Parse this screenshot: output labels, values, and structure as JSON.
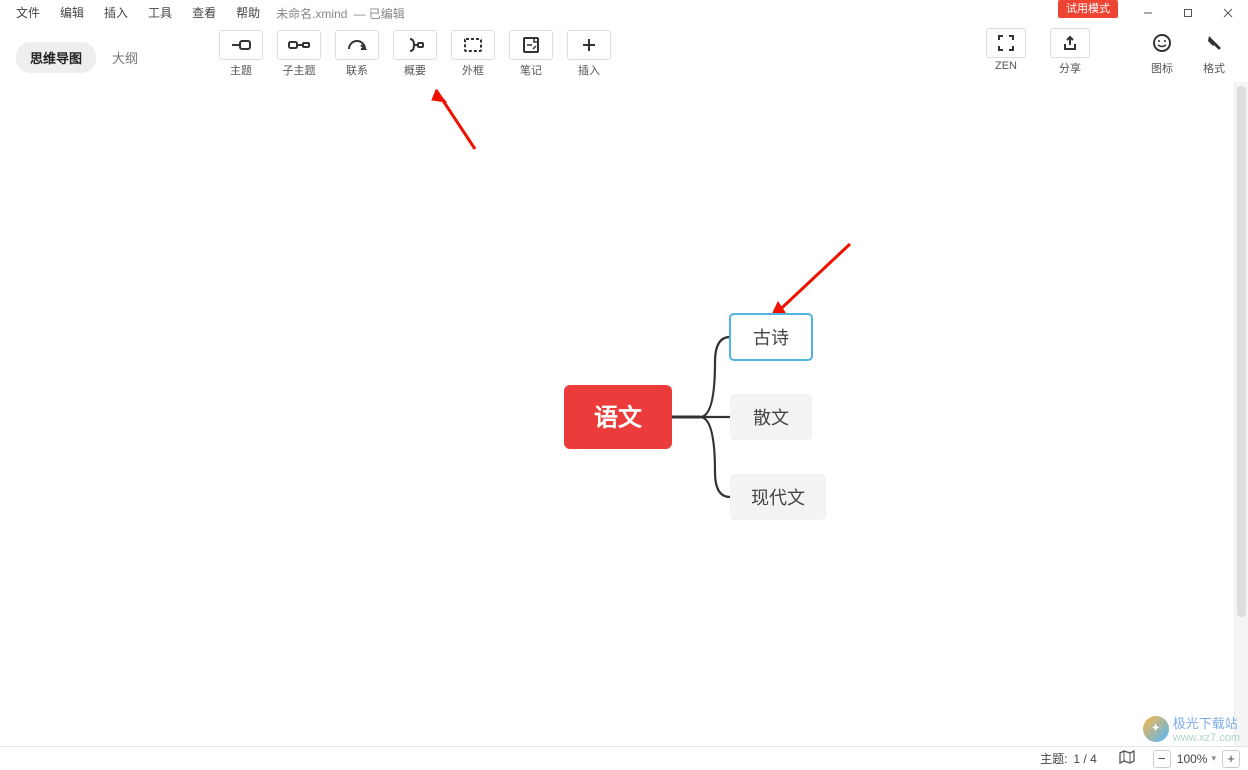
{
  "menu": {
    "items": [
      "文件",
      "编辑",
      "插入",
      "工具",
      "查看",
      "帮助"
    ],
    "filename": "未命名.xmind",
    "status": "— 已编辑",
    "trial": "试用模式"
  },
  "tabs": {
    "mindmap": "思维导图",
    "outline": "大纲"
  },
  "tools": [
    {
      "name": "topic",
      "label": "主题",
      "icon": "topic"
    },
    {
      "name": "subtopic",
      "label": "子主题",
      "icon": "subtopic"
    },
    {
      "name": "relation",
      "label": "联系",
      "icon": "relation"
    },
    {
      "name": "summary",
      "label": "概要",
      "icon": "summary"
    },
    {
      "name": "boundary",
      "label": "外框",
      "icon": "boundary"
    },
    {
      "name": "note",
      "label": "笔记",
      "icon": "note"
    },
    {
      "name": "insert",
      "label": "插入",
      "icon": "insert"
    }
  ],
  "right_tools": {
    "zen": {
      "label": "ZEN"
    },
    "share": {
      "label": "分享"
    },
    "icons": {
      "label": "图标"
    },
    "format": {
      "label": "格式"
    }
  },
  "mindmap": {
    "central": "语文",
    "children": [
      {
        "text": "古诗",
        "selected": true
      },
      {
        "text": "散文",
        "selected": false
      },
      {
        "text": "现代文",
        "selected": false
      }
    ]
  },
  "status": {
    "topic_label": "主题:",
    "topic_index": "1 / 4",
    "zoom": "100%"
  },
  "watermark": {
    "brand": "极光下载站",
    "url": "www.xz7.com"
  }
}
